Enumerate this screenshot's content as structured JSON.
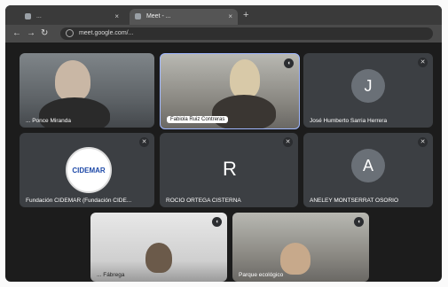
{
  "browser": {
    "tab1_title": "...",
    "tab2_title": "Meet - ...",
    "url": "meet.google.com/..."
  },
  "tiles": [
    {
      "name": "... Ponce Miranda"
    },
    {
      "name": "Fabiola Ruiz Contreras"
    },
    {
      "name": "José Humberto Sarria Herrera",
      "initial": "J"
    },
    {
      "name": "Fundación CIDEMAR (Fundación CIDE...",
      "logo_text": "CIDEMAR"
    },
    {
      "name": "ROCIO ORTEGA CISTERNA",
      "initial": "R"
    },
    {
      "name": "ANELEY MONTSERRAT OSORIO",
      "initial": "A"
    },
    {
      "name": "... Fábrega"
    },
    {
      "name": "Parque ecológico"
    }
  ],
  "colors": {
    "tile_bg": "#3c3f43",
    "avatar_bg": "#6a7077",
    "brand_blue": "#1f4aa8"
  },
  "icons": {
    "mic": "mic-off-icon",
    "tab_close": "close-icon",
    "new_tab": "plus-icon"
  }
}
